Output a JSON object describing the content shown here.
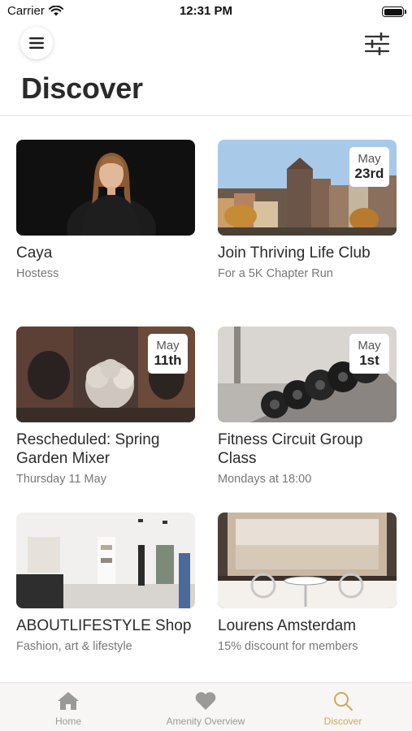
{
  "status_bar": {
    "carrier": "Carrier",
    "time": "12:31 PM"
  },
  "header": {
    "title": "Discover"
  },
  "cards": [
    {
      "title": "Caya",
      "subtitle": "Hostess",
      "badge_month": null,
      "badge_day": null
    },
    {
      "title": "Join Thriving Life Club",
      "subtitle": "For a 5K Chapter Run",
      "badge_month": "May",
      "badge_day": "23rd"
    },
    {
      "title": "Rescheduled: Spring Garden Mixer",
      "subtitle": "Thursday 11 May",
      "badge_month": "May",
      "badge_day": "11th"
    },
    {
      "title": "Fitness Circuit Group Class",
      "subtitle": "Mondays at 18:00",
      "badge_month": "May",
      "badge_day": "1st"
    },
    {
      "title": "ABOUTLIFESTYLE Shop",
      "subtitle": "Fashion, art & lifestyle",
      "badge_month": null,
      "badge_day": null
    },
    {
      "title": "Lourens Amsterdam",
      "subtitle": "15% discount for members",
      "badge_month": null,
      "badge_day": null
    }
  ],
  "tab_bar": {
    "tabs": [
      {
        "label": "Home",
        "icon": "home-icon",
        "active": false
      },
      {
        "label": "Amenity Overview",
        "icon": "heart-icon",
        "active": false
      },
      {
        "label": "Discover",
        "icon": "search-icon",
        "active": true
      }
    ],
    "active_color": "#cfa858",
    "inactive_color": "#9a9a9a"
  }
}
